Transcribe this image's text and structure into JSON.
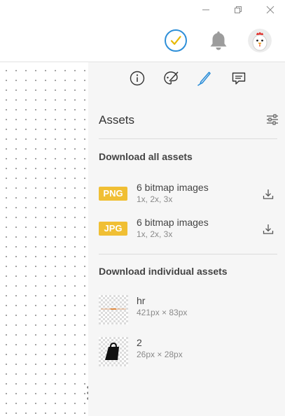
{
  "window": {
    "controls": [
      "minimize",
      "restore",
      "close"
    ]
  },
  "header": {
    "status_icon": "check-circle-icon",
    "notifications_icon": "bell-icon",
    "avatar": "chicken-avatar"
  },
  "colors": {
    "accent": "#2e8fd8",
    "badge": "#f0bf34",
    "check": "#e6b800",
    "panel_bg": "#f6f6f6"
  },
  "panel": {
    "tabs": [
      {
        "icon": "info-icon",
        "active": false
      },
      {
        "icon": "palette-icon",
        "active": false
      },
      {
        "icon": "pen-icon",
        "active": true
      },
      {
        "icon": "comment-icon",
        "active": false
      }
    ],
    "title": "Assets",
    "download_all": {
      "heading": "Download all assets",
      "items": [
        {
          "badge": "PNG",
          "title": "6 bitmap images",
          "scales": "1x, 2x, 3x"
        },
        {
          "badge": "JPG",
          "title": "6 bitmap images",
          "scales": "1x, 2x, 3x"
        }
      ]
    },
    "individual": {
      "heading": "Download individual assets",
      "items": [
        {
          "name": "hr",
          "size": "421px × 83px"
        },
        {
          "name": "2",
          "size": "26px × 28px"
        }
      ]
    }
  }
}
